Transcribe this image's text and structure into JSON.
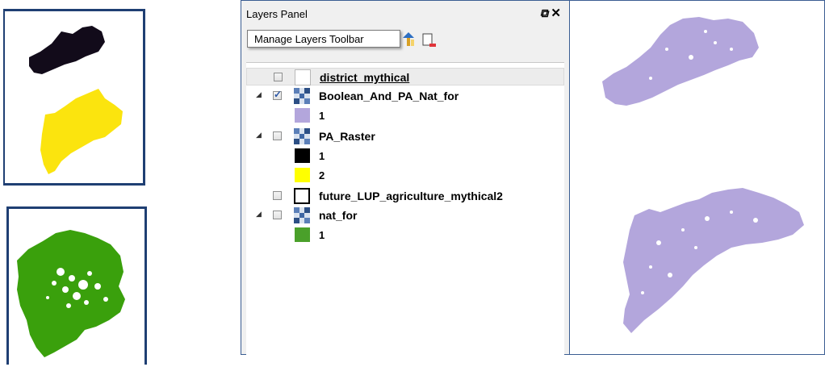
{
  "panel": {
    "title": "Layers Panel",
    "tooltip": "Manage Layers Toolbar"
  },
  "layers": [
    {
      "name": "district_mythical",
      "type": "vector",
      "checked": false,
      "expanded": false,
      "selected": true
    },
    {
      "name": "Boolean_And_PA_Nat_for",
      "type": "raster",
      "checked": true,
      "expanded": true,
      "legend": [
        {
          "label": "1",
          "color": "#b3a6dc"
        }
      ]
    },
    {
      "name": "PA_Raster",
      "type": "raster",
      "checked": false,
      "expanded": true,
      "legend": [
        {
          "label": "1",
          "color": "#000000"
        },
        {
          "label": "2",
          "color": "#ffff00"
        }
      ]
    },
    {
      "name": "future_LUP_agriculture_mythical2",
      "type": "vector",
      "checked": false,
      "expanded": false
    },
    {
      "name": "nat_for",
      "type": "raster",
      "checked": false,
      "expanded": true,
      "legend": [
        {
          "label": "1",
          "color": "#4aa02a"
        }
      ]
    }
  ],
  "colors": {
    "boolean_result": "#b3a6dc",
    "pa_black": "#120b1a",
    "pa_yellow": "#fbe40e",
    "forest_green": "#3aa00c",
    "frame_blue": "#1f3f73"
  },
  "icons": {
    "move_up": "move-layer-up-icon",
    "remove": "remove-layer-icon",
    "float": "float-panel-icon",
    "close": "close-panel-icon"
  }
}
